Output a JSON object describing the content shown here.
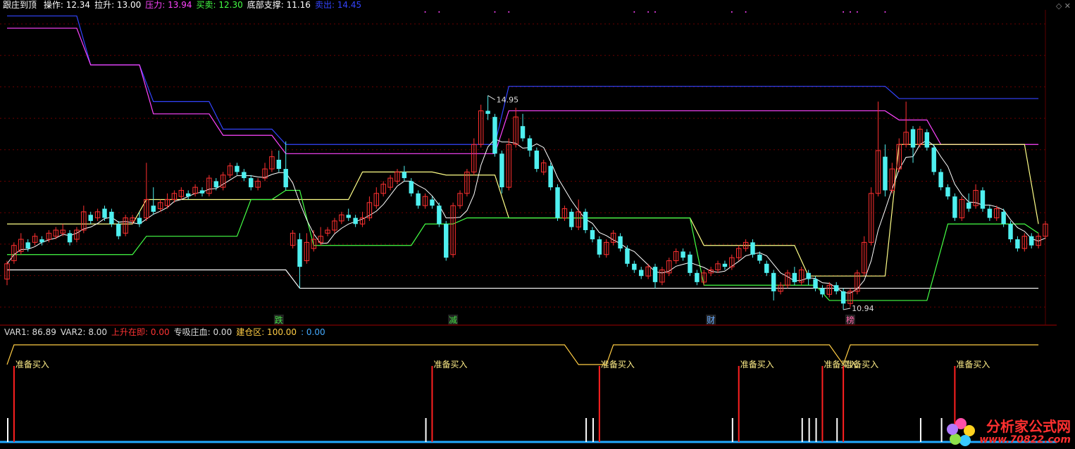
{
  "header": {
    "title": "跟庄到顶",
    "items": [
      {
        "label": "操作: 12.34",
        "color": "#ffffff"
      },
      {
        "label": "拉升: 13.00",
        "color": "#ffffff"
      },
      {
        "label": "压力: 13.94",
        "color": "#ff44ff"
      },
      {
        "label": "买卖: 12.30",
        "color": "#44ff44"
      },
      {
        "label": "底部支撑: 11.16",
        "color": "#ffffff"
      },
      {
        "label": "卖出: 14.45",
        "color": "#3344ff"
      }
    ]
  },
  "indicator_header": {
    "items": [
      {
        "label": "VAR1: 86.89",
        "color": "#dddddd"
      },
      {
        "label": "VAR2: 8.00",
        "color": "#dddddd"
      },
      {
        "label": "上升在即: 0.00",
        "color": "#ff3333"
      },
      {
        "label": "专吸庄血: 0.00",
        "color": "#dddddd"
      },
      {
        "label": "建仓区: 100.00",
        "color": "#ffcc44"
      },
      {
        "label": ": 0.00",
        "color": "#44aaff"
      }
    ]
  },
  "annotations": {
    "high_label": "14.95",
    "low_label": "10.94",
    "markers": [
      "跌",
      "减",
      "财",
      "榜"
    ],
    "buy_signal": "准备买入"
  },
  "watermark": {
    "name": "分析家公式网",
    "url": "www.70822.com"
  },
  "chart_data": [
    {
      "type": "candlestick",
      "panel": "main",
      "title": "跟庄到顶",
      "ylim": [
        10.6,
        15.5
      ],
      "candles": [
        [
          11.1,
          11.35,
          11.0,
          11.4
        ],
        [
          11.4,
          11.65,
          11.35,
          11.7
        ],
        [
          11.55,
          11.75,
          11.5,
          11.85
        ],
        [
          11.7,
          11.6,
          11.55,
          11.75
        ],
        [
          11.7,
          11.8,
          11.65,
          11.85
        ],
        [
          11.75,
          11.7,
          11.65,
          11.8
        ],
        [
          11.75,
          11.85,
          11.7,
          11.9
        ],
        [
          11.8,
          11.9,
          11.75,
          11.95
        ],
        [
          11.85,
          11.9,
          11.8,
          12.0
        ],
        [
          11.85,
          11.7,
          11.65,
          11.9
        ],
        [
          11.75,
          11.9,
          11.7,
          11.95
        ],
        [
          11.9,
          12.2,
          11.85,
          12.3
        ],
        [
          12.15,
          12.05,
          12.0,
          12.2
        ],
        [
          12.1,
          12.2,
          12.05,
          12.25
        ],
        [
          12.25,
          12.1,
          12.05,
          12.3
        ],
        [
          12.2,
          12.0,
          11.95,
          12.25
        ],
        [
          12.0,
          11.8,
          11.75,
          12.05
        ],
        [
          11.85,
          12.1,
          11.8,
          12.15
        ],
        [
          12.05,
          12.1,
          12.0,
          12.15
        ],
        [
          12.1,
          12.0,
          11.95,
          12.2
        ],
        [
          12.1,
          12.4,
          12.05,
          13.0
        ],
        [
          12.3,
          12.2,
          12.15,
          12.6
        ],
        [
          12.25,
          12.35,
          12.2,
          12.4
        ],
        [
          12.3,
          12.4,
          12.25,
          12.5
        ],
        [
          12.4,
          12.5,
          12.35,
          12.55
        ],
        [
          12.45,
          12.55,
          12.4,
          12.6
        ],
        [
          12.5,
          12.45,
          12.4,
          12.55
        ],
        [
          12.5,
          12.6,
          12.45,
          12.65
        ],
        [
          12.55,
          12.5,
          12.45,
          12.6
        ],
        [
          12.5,
          12.75,
          12.45,
          12.8
        ],
        [
          12.7,
          12.6,
          12.55,
          12.75
        ],
        [
          12.6,
          12.8,
          12.55,
          12.85
        ],
        [
          12.8,
          12.95,
          12.75,
          13.0
        ],
        [
          12.95,
          12.85,
          12.8,
          13.0
        ],
        [
          12.85,
          12.75,
          12.7,
          12.9
        ],
        [
          12.75,
          12.6,
          12.55,
          12.8
        ],
        [
          12.6,
          12.7,
          12.55,
          12.75
        ],
        [
          12.75,
          12.9,
          12.7,
          13.0
        ],
        [
          12.9,
          13.1,
          12.85,
          13.2
        ],
        [
          13.05,
          12.9,
          12.85,
          13.2
        ],
        [
          12.9,
          12.6,
          12.55,
          13.35
        ],
        [
          11.65,
          11.85,
          11.6,
          11.9
        ],
        [
          11.75,
          11.3,
          10.95,
          11.85
        ],
        [
          11.4,
          11.7,
          11.35,
          11.85
        ],
        [
          11.6,
          11.75,
          11.55,
          11.9
        ],
        [
          11.7,
          11.8,
          11.65,
          11.95
        ],
        [
          11.85,
          11.9,
          11.8,
          11.95
        ],
        [
          11.9,
          12.05,
          11.85,
          12.1
        ],
        [
          12.05,
          12.15,
          12.0,
          12.2
        ],
        [
          12.15,
          12.1,
          12.05,
          12.25
        ],
        [
          12.1,
          12.0,
          11.95,
          12.15
        ],
        [
          12.0,
          12.1,
          11.95,
          12.2
        ],
        [
          12.1,
          12.35,
          12.05,
          12.45
        ],
        [
          12.3,
          12.5,
          12.25,
          12.6
        ],
        [
          12.5,
          12.65,
          12.45,
          12.7
        ],
        [
          12.6,
          12.75,
          12.55,
          12.8
        ],
        [
          12.7,
          12.85,
          12.65,
          12.9
        ],
        [
          12.85,
          12.75,
          12.7,
          12.95
        ],
        [
          12.7,
          12.5,
          12.45,
          12.75
        ],
        [
          12.5,
          12.3,
          12.25,
          12.55
        ],
        [
          12.3,
          12.45,
          12.25,
          12.5
        ],
        [
          12.4,
          12.3,
          12.25,
          12.45
        ],
        [
          12.3,
          12.0,
          11.95,
          12.35
        ],
        [
          12.0,
          11.45,
          11.4,
          12.05
        ],
        [
          11.5,
          12.3,
          11.45,
          12.35
        ],
        [
          12.3,
          12.5,
          12.25,
          12.55
        ],
        [
          12.5,
          12.85,
          12.45,
          12.9
        ],
        [
          12.85,
          13.3,
          12.8,
          13.4
        ],
        [
          13.3,
          13.85,
          13.25,
          13.95
        ],
        [
          13.85,
          13.8,
          13.7,
          14.1
        ],
        [
          13.75,
          13.15,
          13.1,
          13.8
        ],
        [
          13.15,
          12.6,
          12.5,
          13.2
        ],
        [
          12.6,
          13.3,
          12.55,
          13.4
        ],
        [
          13.3,
          13.75,
          13.25,
          13.9
        ],
        [
          13.6,
          13.4,
          13.35,
          13.8
        ],
        [
          13.4,
          13.2,
          13.1,
          13.45
        ],
        [
          13.2,
          12.9,
          12.85,
          13.25
        ],
        [
          12.85,
          13.0,
          12.8,
          13.05
        ],
        [
          12.95,
          12.6,
          12.55,
          13.0
        ],
        [
          12.6,
          12.1,
          12.05,
          12.65
        ],
        [
          12.1,
          12.25,
          12.05,
          12.3
        ],
        [
          12.2,
          11.95,
          11.9,
          12.25
        ],
        [
          11.95,
          12.2,
          11.9,
          12.4
        ],
        [
          12.2,
          11.9,
          11.85,
          12.25
        ],
        [
          11.9,
          11.75,
          11.7,
          11.95
        ],
        [
          11.75,
          11.5,
          11.45,
          11.8
        ],
        [
          11.5,
          11.7,
          11.45,
          11.75
        ],
        [
          11.7,
          11.85,
          11.65,
          11.9
        ],
        [
          11.8,
          11.6,
          11.55,
          11.85
        ],
        [
          11.6,
          11.35,
          11.3,
          11.65
        ],
        [
          11.35,
          11.25,
          11.2,
          11.4
        ],
        [
          11.25,
          11.15,
          11.1,
          11.3
        ],
        [
          11.15,
          11.3,
          11.1,
          11.35
        ],
        [
          11.3,
          11.05,
          10.95,
          11.35
        ],
        [
          11.05,
          11.25,
          11.0,
          11.3
        ],
        [
          11.2,
          11.4,
          11.15,
          11.45
        ],
        [
          11.4,
          11.55,
          11.35,
          11.6
        ],
        [
          11.55,
          11.45,
          11.4,
          11.6
        ],
        [
          11.5,
          11.2,
          11.15,
          11.55
        ],
        [
          11.2,
          11.05,
          11.0,
          11.25
        ],
        [
          11.05,
          11.2,
          11.0,
          11.25
        ],
        [
          11.2,
          11.25,
          11.15,
          11.3
        ],
        [
          11.25,
          11.35,
          11.2,
          11.4
        ],
        [
          11.35,
          11.3,
          11.25,
          11.4
        ],
        [
          11.3,
          11.45,
          11.25,
          11.5
        ],
        [
          11.45,
          11.6,
          11.4,
          11.65
        ],
        [
          11.6,
          11.7,
          11.55,
          11.75
        ],
        [
          11.7,
          11.5,
          11.45,
          11.75
        ],
        [
          11.5,
          11.4,
          11.35,
          11.55
        ],
        [
          11.35,
          11.2,
          11.15,
          11.4
        ],
        [
          11.2,
          10.9,
          10.75,
          11.25
        ],
        [
          10.9,
          11.0,
          10.85,
          11.05
        ],
        [
          11.0,
          11.2,
          10.95,
          11.25
        ],
        [
          11.2,
          11.05,
          11.0,
          11.3
        ],
        [
          11.05,
          11.25,
          11.0,
          11.3
        ],
        [
          11.2,
          11.1,
          11.0,
          11.25
        ],
        [
          11.1,
          10.95,
          10.9,
          11.15
        ],
        [
          10.95,
          10.85,
          10.8,
          11.0
        ],
        [
          10.85,
          11.0,
          10.8,
          11.05
        ],
        [
          11.0,
          10.9,
          10.85,
          11.05
        ],
        [
          10.9,
          10.7,
          10.6,
          10.95
        ],
        [
          10.7,
          10.9,
          10.65,
          10.95
        ],
        [
          10.9,
          11.2,
          10.85,
          11.25
        ],
        [
          11.2,
          11.7,
          11.15,
          11.8
        ],
        [
          11.7,
          12.5,
          11.65,
          12.6
        ],
        [
          12.5,
          13.2,
          12.45,
          14.0
        ],
        [
          13.1,
          12.55,
          12.45,
          13.3
        ],
        [
          12.55,
          12.9,
          12.5,
          13.0
        ],
        [
          12.9,
          13.3,
          12.85,
          13.4
        ],
        [
          13.3,
          13.5,
          13.25,
          14.0
        ],
        [
          13.55,
          13.25,
          13.0,
          13.6
        ],
        [
          13.3,
          13.55,
          13.25,
          13.6
        ],
        [
          13.5,
          13.25,
          13.2,
          13.55
        ],
        [
          13.25,
          12.85,
          12.8,
          13.3
        ],
        [
          12.85,
          12.6,
          12.55,
          12.9
        ],
        [
          12.6,
          12.45,
          12.4,
          12.65
        ],
        [
          12.45,
          12.1,
          12.05,
          12.5
        ],
        [
          12.1,
          12.4,
          12.05,
          12.45
        ],
        [
          12.35,
          12.25,
          12.2,
          12.5
        ],
        [
          12.3,
          12.55,
          12.25,
          12.65
        ],
        [
          12.55,
          12.25,
          12.2,
          12.6
        ],
        [
          12.25,
          12.1,
          12.05,
          12.3
        ],
        [
          12.1,
          12.25,
          12.05,
          12.3
        ],
        [
          12.2,
          12.0,
          11.95,
          12.25
        ],
        [
          12.0,
          11.75,
          11.7,
          12.05
        ],
        [
          11.75,
          11.6,
          11.55,
          11.8
        ],
        [
          11.6,
          11.8,
          11.55,
          11.85
        ],
        [
          11.8,
          11.65,
          11.6,
          11.85
        ],
        [
          11.65,
          11.8,
          11.6,
          11.85
        ],
        [
          11.8,
          12.0,
          11.75,
          12.05
        ]
      ],
      "series": [
        {
          "name": "卖出",
          "color": "#3344ff",
          "values_step": [
            [
              0,
              15.4
            ],
            [
              12,
              14.6
            ],
            [
              21,
              14.0
            ],
            [
              31,
              13.55
            ],
            [
              40,
              13.3
            ],
            [
              72,
              14.25
            ],
            [
              128,
              14.05
            ],
            [
              148,
              14.05
            ]
          ]
        },
        {
          "name": "压力",
          "color": "#ff44ff",
          "values_step": [
            [
              0,
              15.2
            ],
            [
              12,
              14.6
            ],
            [
              21,
              13.8
            ],
            [
              31,
              13.45
            ],
            [
              40,
              13.15
            ],
            [
              72,
              13.85
            ],
            [
              128,
              13.7
            ],
            [
              134,
              13.3
            ],
            [
              148,
              13.3
            ]
          ]
        },
        {
          "name": "底部支撑",
          "color": "#ffffff",
          "values_step": [
            [
              0,
              11.25
            ],
            [
              40,
              11.25
            ],
            [
              42,
              10.95
            ],
            [
              148,
              10.95
            ]
          ]
        },
        {
          "name": "拉升",
          "color": "#ffff88",
          "values_step": [
            [
              0,
              12.0
            ],
            [
              10,
              12.0
            ],
            [
              20,
              12.4
            ],
            [
              40,
              12.4
            ],
            [
              51,
              12.85
            ],
            [
              63,
              12.8
            ],
            [
              72,
              12.1
            ],
            [
              100,
              11.65
            ],
            [
              115,
              11.15
            ],
            [
              120,
              11.15
            ],
            [
              128,
              13.3
            ],
            [
              140,
              13.3
            ],
            [
              148,
              12.0
            ]
          ]
        },
        {
          "name": "买卖",
          "color": "#44ff44",
          "values_step": [
            [
              0,
              11.5
            ],
            [
              10,
              11.5
            ],
            [
              20,
              11.8
            ],
            [
              35,
              12.4
            ],
            [
              40,
              12.55
            ],
            [
              44,
              11.65
            ],
            [
              56,
              11.65
            ],
            [
              60,
              12.0
            ],
            [
              66,
              12.1
            ],
            [
              100,
              11.0
            ],
            [
              118,
              10.75
            ],
            [
              132,
              10.75
            ],
            [
              135,
              12.0
            ],
            [
              148,
              11.85
            ]
          ]
        }
      ]
    },
    {
      "type": "line",
      "panel": "indicator",
      "ylim": [
        0,
        100
      ],
      "series": [
        {
          "name": "建仓区",
          "color": "#ffcc44",
          "values_step": [
            [
              0,
              70
            ],
            [
              1,
              100
            ],
            [
              80,
              100
            ],
            [
              82,
              50
            ],
            [
              86,
              50
            ],
            [
              87,
              100
            ],
            [
              118,
              100
            ],
            [
              120,
              50
            ],
            [
              121,
              100
            ],
            [
              148,
              100
            ]
          ]
        }
      ],
      "signal_bars_red": [
        1,
        61,
        85,
        105,
        117,
        120,
        136
      ],
      "signal_bars_white": [
        0,
        60,
        83,
        84,
        104,
        114,
        115,
        116,
        119,
        131,
        134
      ]
    }
  ]
}
